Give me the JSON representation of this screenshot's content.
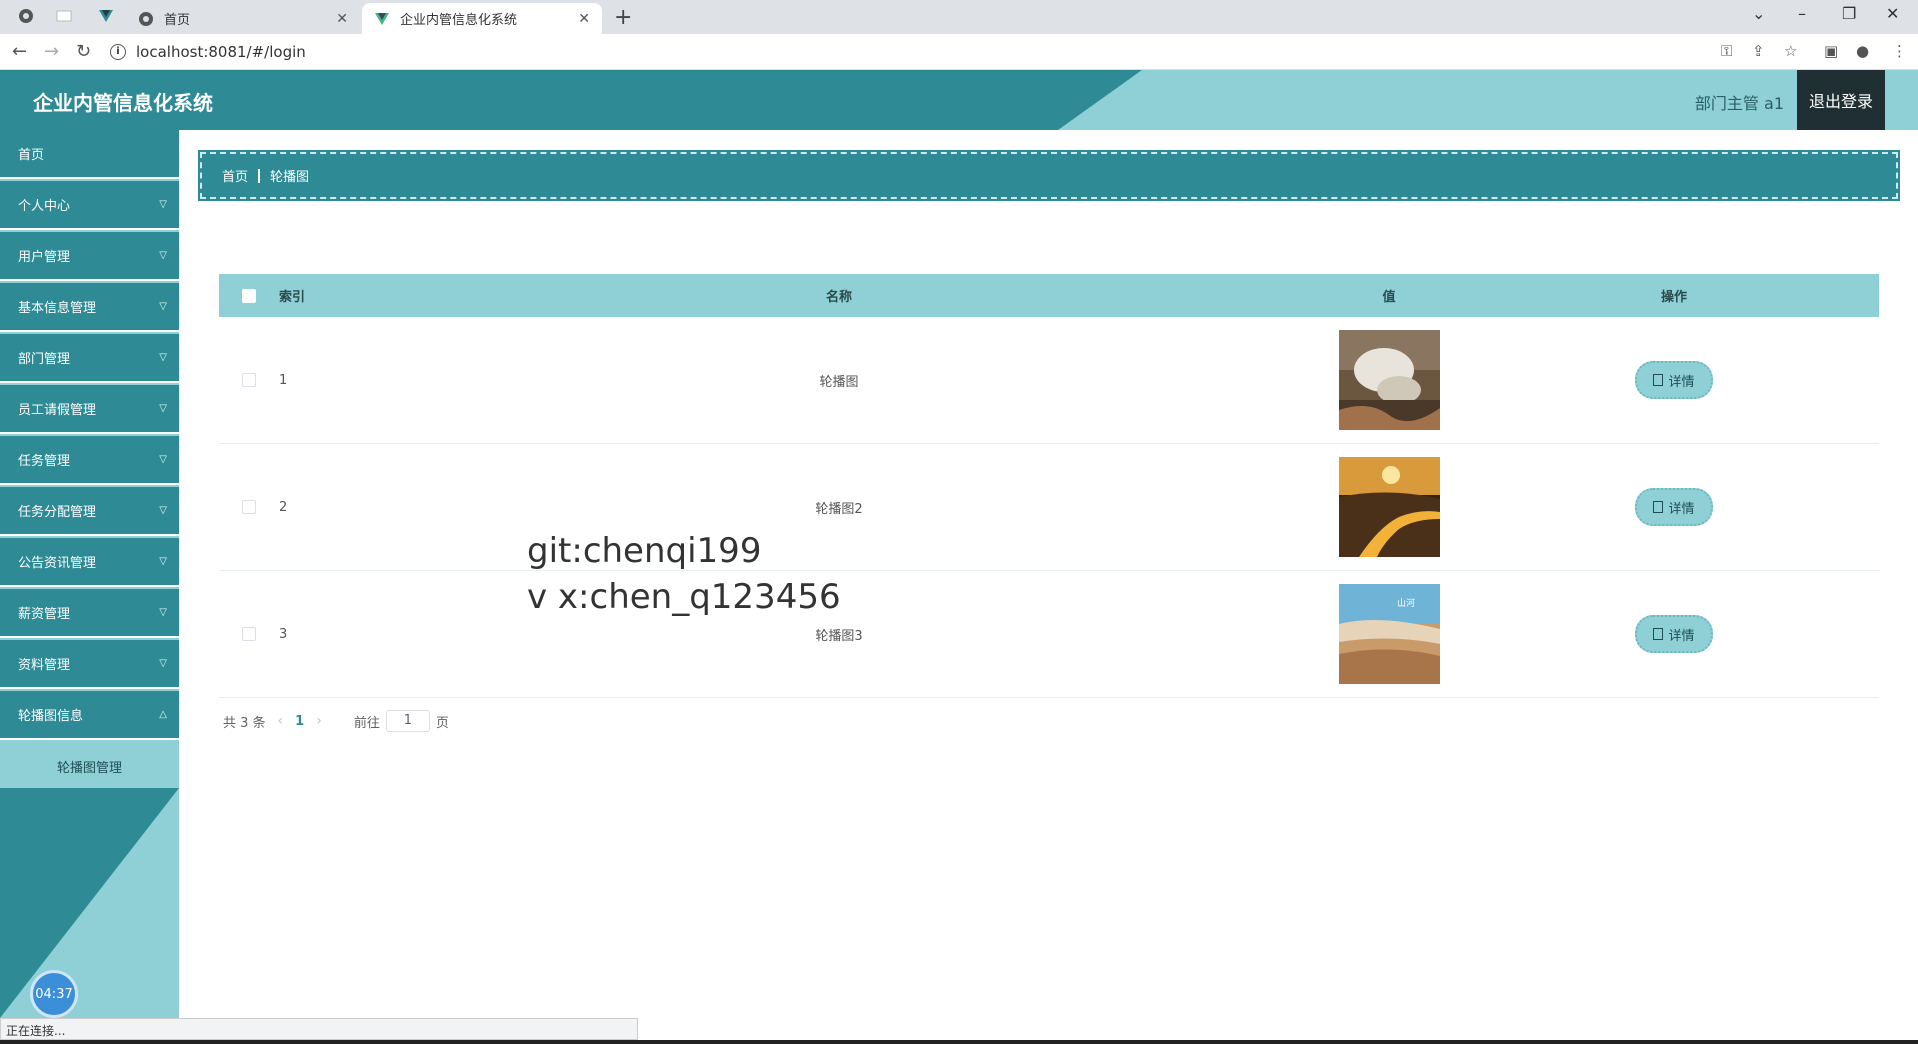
{
  "browser": {
    "tabs": [
      {
        "label": "首页",
        "active": false
      },
      {
        "label": "企业内管信息化系统",
        "active": true
      }
    ],
    "new_tab": "+",
    "url": "localhost:8081/#/login",
    "status_text": "正在连接..."
  },
  "header": {
    "title": "企业内管信息化系统",
    "user": "部门主管 a1",
    "logout": "退出登录"
  },
  "sidebar": {
    "items": [
      {
        "label": "首页"
      },
      {
        "label": "个人中心"
      },
      {
        "label": "用户管理"
      },
      {
        "label": "基本信息管理"
      },
      {
        "label": "部门管理"
      },
      {
        "label": "员工请假管理"
      },
      {
        "label": "任务管理"
      },
      {
        "label": "任务分配管理"
      },
      {
        "label": "公告资讯管理"
      },
      {
        "label": "薪资管理"
      },
      {
        "label": "资料管理"
      },
      {
        "label": "轮播图信息"
      }
    ],
    "submenu": "轮播图管理",
    "clock": "04:37"
  },
  "breadcrumb": {
    "home": "首页",
    "current": "轮播图"
  },
  "table": {
    "columns": [
      "索引",
      "名称",
      "值",
      "操作"
    ],
    "rows": [
      {
        "index": "1",
        "name": "轮播图",
        "action": "详情"
      },
      {
        "index": "2",
        "name": "轮播图2",
        "action": "详情"
      },
      {
        "index": "3",
        "name": "轮播图3",
        "action": "详情"
      }
    ]
  },
  "pagination": {
    "total": "共 3 条",
    "current_page": "1",
    "goto_label": "前往",
    "goto_value": "1",
    "page_suffix": "页"
  },
  "watermark": {
    "line1": "git:chenqi199",
    "line2": "v x:chen_q123456"
  },
  "colors": {
    "primary": "#2e8b96",
    "light": "#8fcfd6"
  }
}
